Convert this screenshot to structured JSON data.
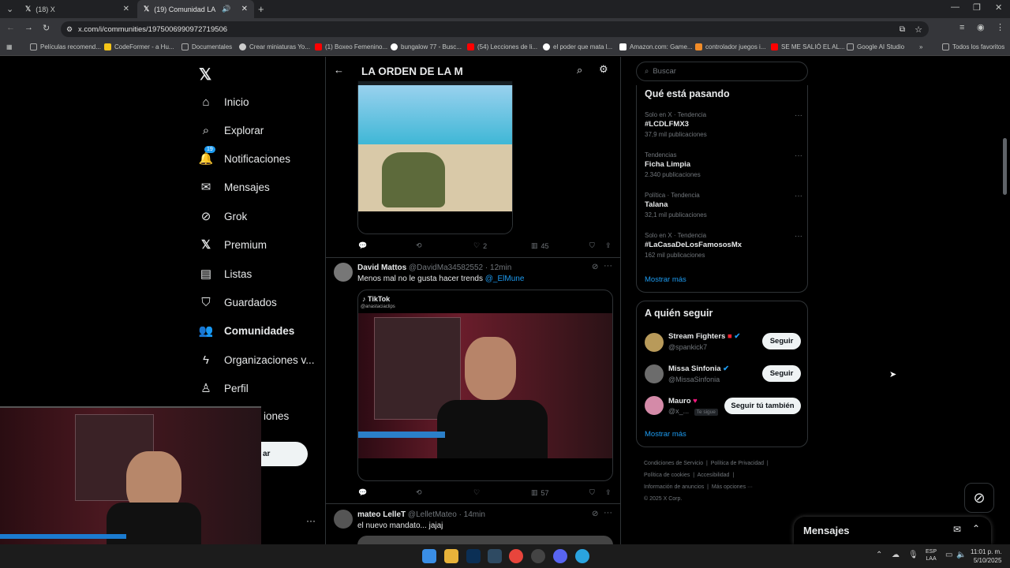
{
  "browser": {
    "tabs": [
      {
        "title": "(18) X"
      },
      {
        "title": "(19) Comunidad LA ORDEN"
      }
    ],
    "url": "x.com/i/communities/1975006990972719506",
    "bookmarks": [
      "Películas recomend...",
      "CodeFormer - a Hu...",
      "Documentales",
      "Crear miniaturas Yo...",
      "(1) Boxeo Femenino...",
      "bungalow 77 - Busc...",
      "(54) Lecciones de li...",
      "el poder que mata l...",
      "Amazon.com: Game...",
      "controlador juegos i...",
      "SE ME SALIÓ EL AL...",
      "Google AI Studio"
    ],
    "all_bookmarks": "Todos los favoritos"
  },
  "nav": {
    "items": [
      {
        "label": "Inicio"
      },
      {
        "label": "Explorar"
      },
      {
        "label": "Notificaciones"
      },
      {
        "label": "Mensajes"
      },
      {
        "label": "Grok"
      },
      {
        "label": "Premium"
      },
      {
        "label": "Listas"
      },
      {
        "label": "Guardados"
      },
      {
        "label": "Comunidades"
      },
      {
        "label": "Organizaciones v..."
      },
      {
        "label": "Perfil"
      },
      {
        "label": "iones"
      }
    ],
    "notif_badge": "19",
    "post_btn_partial": "ar"
  },
  "community": {
    "title": "LA ORDEN DE LA M"
  },
  "tweets": [
    {
      "replies": "",
      "retweets": "",
      "likes": "2",
      "views": "45"
    },
    {
      "name": "David Mattos",
      "handle": "@DavidMa34582552",
      "time": "· 12min",
      "text": "Menos mal no le gusta hacer trends",
      "mention": "@_ElMune",
      "tiktok": "TikTok",
      "tiktok_user": "@anastaciaclips",
      "likes": "",
      "views": "57"
    },
    {
      "name": "mateo LelleT",
      "handle": "@LelletMateo",
      "time": "· 14min",
      "text": "el nuevo mandato... jajaj"
    }
  ],
  "search": {
    "placeholder": "Buscar"
  },
  "trending": {
    "title": "Qué está pasando",
    "items": [
      {
        "meta": "Solo en X · Tendencia",
        "name": "#LCDLFMX3",
        "count": "37,9 mil publicaciones"
      },
      {
        "meta": "Tendencias",
        "name": "Ficha Limpia",
        "count": "2.340 publicaciones"
      },
      {
        "meta": "Política · Tendencia",
        "name": "Talana",
        "count": "32,1 mil publicaciones"
      },
      {
        "meta": "Solo en X · Tendencia",
        "name": "#LaCasaDeLosFamososMx",
        "count": "162 mil publicaciones"
      }
    ],
    "show_more": "Mostrar más"
  },
  "who_to_follow": {
    "title": "A quién seguir",
    "items": [
      {
        "name": "Stream Fighters",
        "handle": "@spankick7",
        "button": "Seguir"
      },
      {
        "name": "Missa Sinfonia",
        "handle": "@MissaSinfonia",
        "button": "Seguir"
      },
      {
        "name": "Mauro",
        "handle": "@x_...",
        "follows_you": "Te sigue",
        "button": "Seguir tú también"
      }
    ],
    "show_more": "Mostrar más"
  },
  "footer": {
    "line1a": "Condiciones de Servicio",
    "line1b": "Política de Privacidad",
    "line2a": "Política de cookies",
    "line2b": "Accesibilidad",
    "line3a": "Información de anuncios",
    "line3b": "Más opciones ···",
    "copyright": "© 2025 X Corp."
  },
  "messages_drawer": {
    "title": "Mensajes"
  },
  "taskbar": {
    "lang1": "ESP",
    "lang2": "LAA",
    "time": "11:01 p. m.",
    "date": "5/10/2025"
  },
  "colors": {
    "accent": "#1d9bf0",
    "bg": "#000000",
    "border": "#2f3336"
  }
}
